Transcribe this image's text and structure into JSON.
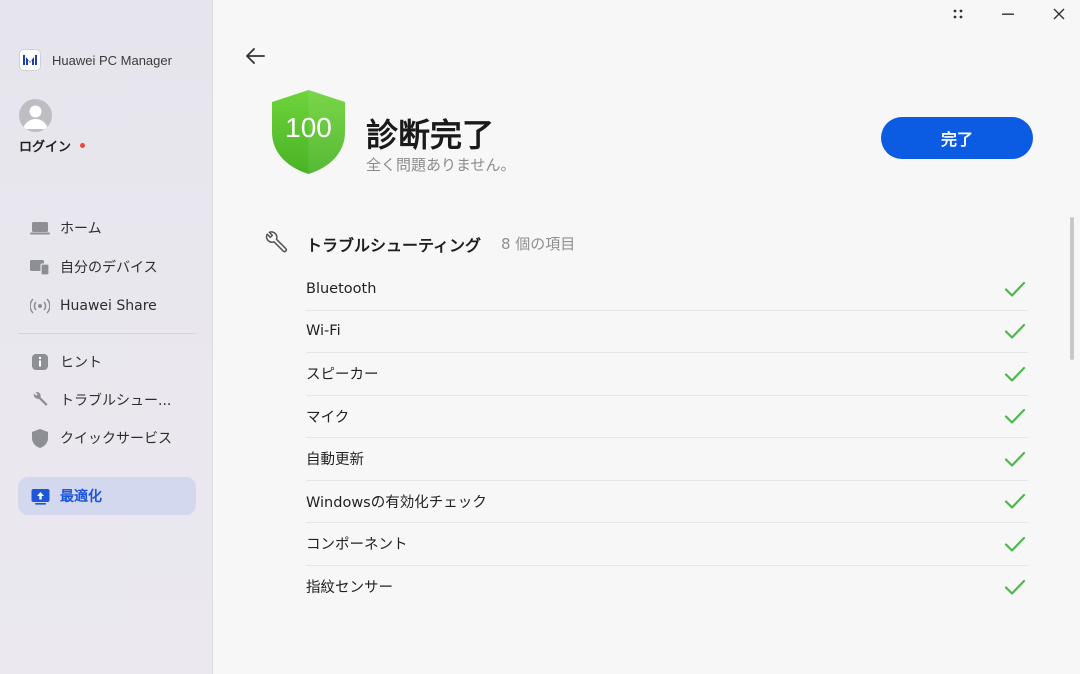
{
  "app": {
    "name": "Huawei PC Manager"
  },
  "user": {
    "login_label": "ログイン"
  },
  "sidebar": {
    "items": [
      {
        "label": "ホーム",
        "icon": "laptop-icon"
      },
      {
        "label": "自分のデバイス",
        "icon": "devices-icon"
      },
      {
        "label": "Huawei Share",
        "icon": "share-waves-icon"
      },
      {
        "label": "ヒント",
        "icon": "info-icon"
      },
      {
        "label": "トラブルシュー...",
        "icon": "wrench-icon"
      },
      {
        "label": "クイックサービス",
        "icon": "shield-icon"
      },
      {
        "label": "最適化",
        "icon": "optimize-icon",
        "active": true
      }
    ]
  },
  "result": {
    "score": "100",
    "title": "診断完了",
    "subtitle": "全く問題ありません。",
    "done_button": "完了"
  },
  "section": {
    "title": "トラブルシューティング",
    "count_label": "8 個の項目"
  },
  "checks": [
    {
      "label": "Bluetooth",
      "status": "ok"
    },
    {
      "label": "Wi-Fi",
      "status": "ok"
    },
    {
      "label": "スピーカー",
      "status": "ok"
    },
    {
      "label": "マイク",
      "status": "ok"
    },
    {
      "label": "自動更新",
      "status": "ok"
    },
    {
      "label": "Windowsの有効化チェック",
      "status": "ok"
    },
    {
      "label": "コンポーネント",
      "status": "ok"
    },
    {
      "label": "指紋センサー",
      "status": "ok"
    }
  ],
  "colors": {
    "accent": "#0b5be3",
    "check_green": "#4cb84c",
    "shield_green": "#5cc72a",
    "active_nav_bg": "#d4d8ef"
  }
}
